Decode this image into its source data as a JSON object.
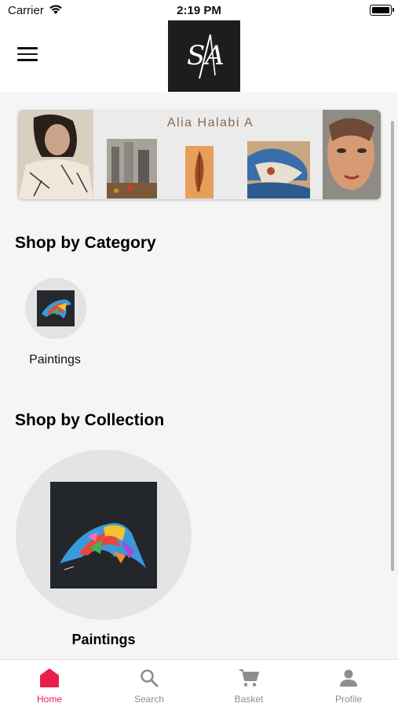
{
  "status_bar": {
    "carrier": "Carrier",
    "time": "2:19 PM"
  },
  "header": {
    "menu_icon": "hamburger-menu-icon",
    "logo_text": "SA"
  },
  "banner": {
    "title": "Alia Halabi A"
  },
  "shop_by_category": {
    "title": "Shop by Category",
    "items": [
      {
        "label": "Paintings"
      }
    ]
  },
  "shop_by_collection": {
    "title": "Shop by Collection",
    "items": [
      {
        "label": "Paintings"
      }
    ]
  },
  "tab_bar": {
    "tabs": [
      {
        "label": "Home",
        "icon": "home-icon",
        "active": true
      },
      {
        "label": "Search",
        "icon": "search-icon",
        "active": false
      },
      {
        "label": "Basket",
        "icon": "cart-icon",
        "active": false
      },
      {
        "label": "Profile",
        "icon": "person-icon",
        "active": false
      }
    ]
  },
  "colors": {
    "accent": "#e91e4d",
    "inactive": "#8e8e8e",
    "background": "#f5f5f5",
    "logo_bg": "#1d1d1d"
  }
}
